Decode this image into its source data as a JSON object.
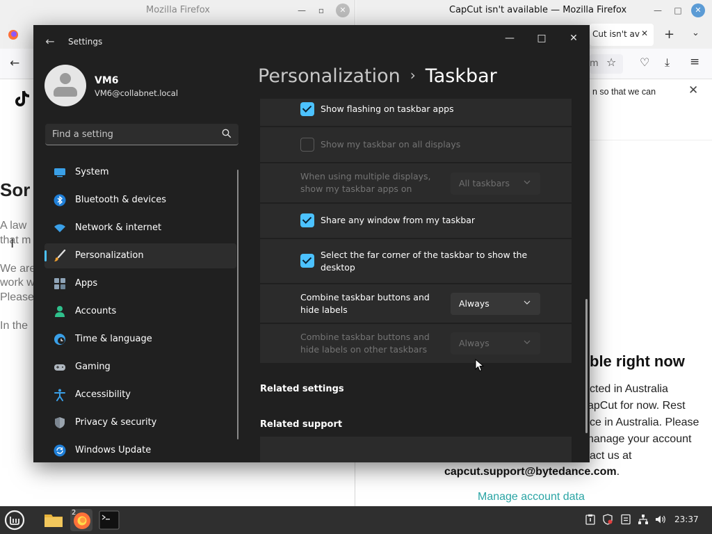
{
  "background": {
    "left_window": {
      "title": "Mozilla Firefox"
    },
    "right_window": {
      "title": "CapCut isn't available — Mozilla Firefox",
      "tab_title": "Cut isn't av",
      "url_fragment": "m",
      "notice_fragment": "n so that we can",
      "heading_fragment": "ble right now",
      "body_lines": [
        "cted in Australia",
        "apCut for now. Rest",
        "ce in Australia. Please",
        "nanage your account",
        "act us at"
      ],
      "support_email": "capcut.support@bytedance.com",
      "email_suffix": ".",
      "manage_link": "Manage account data"
    },
    "left_page_fragments": {
      "heading": "Sor",
      "line1": "A law",
      "line2": "that m",
      "line3": "We are",
      "line4": "work w",
      "line5": "Please",
      "line6": "In the"
    }
  },
  "settings": {
    "app_title": "Settings",
    "user": {
      "name": "VM6",
      "email": "VM6@collabnet.local"
    },
    "search": {
      "placeholder": "Find a setting"
    },
    "nav": [
      {
        "label": "System",
        "icon": "monitor-icon",
        "active": false
      },
      {
        "label": "Bluetooth & devices",
        "icon": "bluetooth-icon",
        "active": false
      },
      {
        "label": "Network & internet",
        "icon": "wifi-icon",
        "active": false
      },
      {
        "label": "Personalization",
        "icon": "paintbrush-icon",
        "active": true
      },
      {
        "label": "Apps",
        "icon": "apps-icon",
        "active": false
      },
      {
        "label": "Accounts",
        "icon": "person-icon",
        "active": false
      },
      {
        "label": "Time & language",
        "icon": "clock-globe-icon",
        "active": false
      },
      {
        "label": "Gaming",
        "icon": "gamepad-icon",
        "active": false
      },
      {
        "label": "Accessibility",
        "icon": "accessibility-icon",
        "active": false
      },
      {
        "label": "Privacy & security",
        "icon": "shield-icon",
        "active": false
      },
      {
        "label": "Windows Update",
        "icon": "refresh-icon",
        "active": false
      }
    ],
    "breadcrumb": {
      "parent": "Personalization",
      "separator": "›",
      "current": "Taskbar"
    },
    "options": {
      "flashing": {
        "label": "Show flashing on taskbar apps",
        "checked": true,
        "enabled": true
      },
      "all_displays": {
        "label": "Show my taskbar on all displays",
        "checked": false,
        "enabled": false
      },
      "multi_display": {
        "label_line1": "When using multiple displays,",
        "label_line2": "show my taskbar apps on",
        "value": "All taskbars",
        "enabled": false
      },
      "share_window": {
        "label": "Share any window from my taskbar",
        "checked": true,
        "enabled": true
      },
      "far_corner": {
        "label_line1": "Select the far corner of the taskbar to show the",
        "label_line2": "desktop",
        "checked": true,
        "enabled": true
      },
      "combine": {
        "label_line1": "Combine taskbar buttons and",
        "label_line2": "hide labels",
        "value": "Always",
        "enabled": true
      },
      "combine_other": {
        "label_line1": "Combine taskbar buttons and",
        "label_line2": "hide labels on other taskbars",
        "value": "Always",
        "enabled": false
      }
    },
    "related_settings": "Related settings",
    "related_support": "Related support"
  },
  "panel": {
    "clock": "23:37",
    "firefox_badge": "2"
  },
  "colors": {
    "accent": "#4cc2ff",
    "settings_bg": "#202020",
    "card_bg": "#2b2b2b",
    "link_teal": "#2aa5a5"
  }
}
